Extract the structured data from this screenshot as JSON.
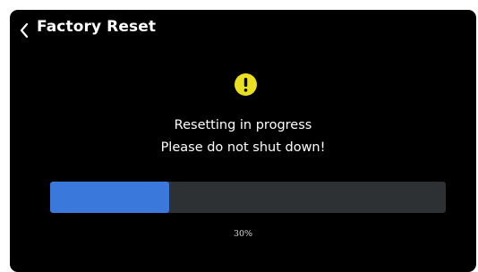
{
  "header": {
    "title": "Factory Reset",
    "back_icon": "chevron-left-icon"
  },
  "status": {
    "icon": "warning-icon",
    "icon_color": "#e8e021",
    "line1": "Resetting in progress",
    "line2": "Please do not shut down!"
  },
  "progress": {
    "value": 0.3,
    "label": "30%",
    "fill_color": "#3a78db",
    "track_color": "#2e3134"
  },
  "colors": {
    "background": "#000000",
    "text": "#ffffff"
  }
}
